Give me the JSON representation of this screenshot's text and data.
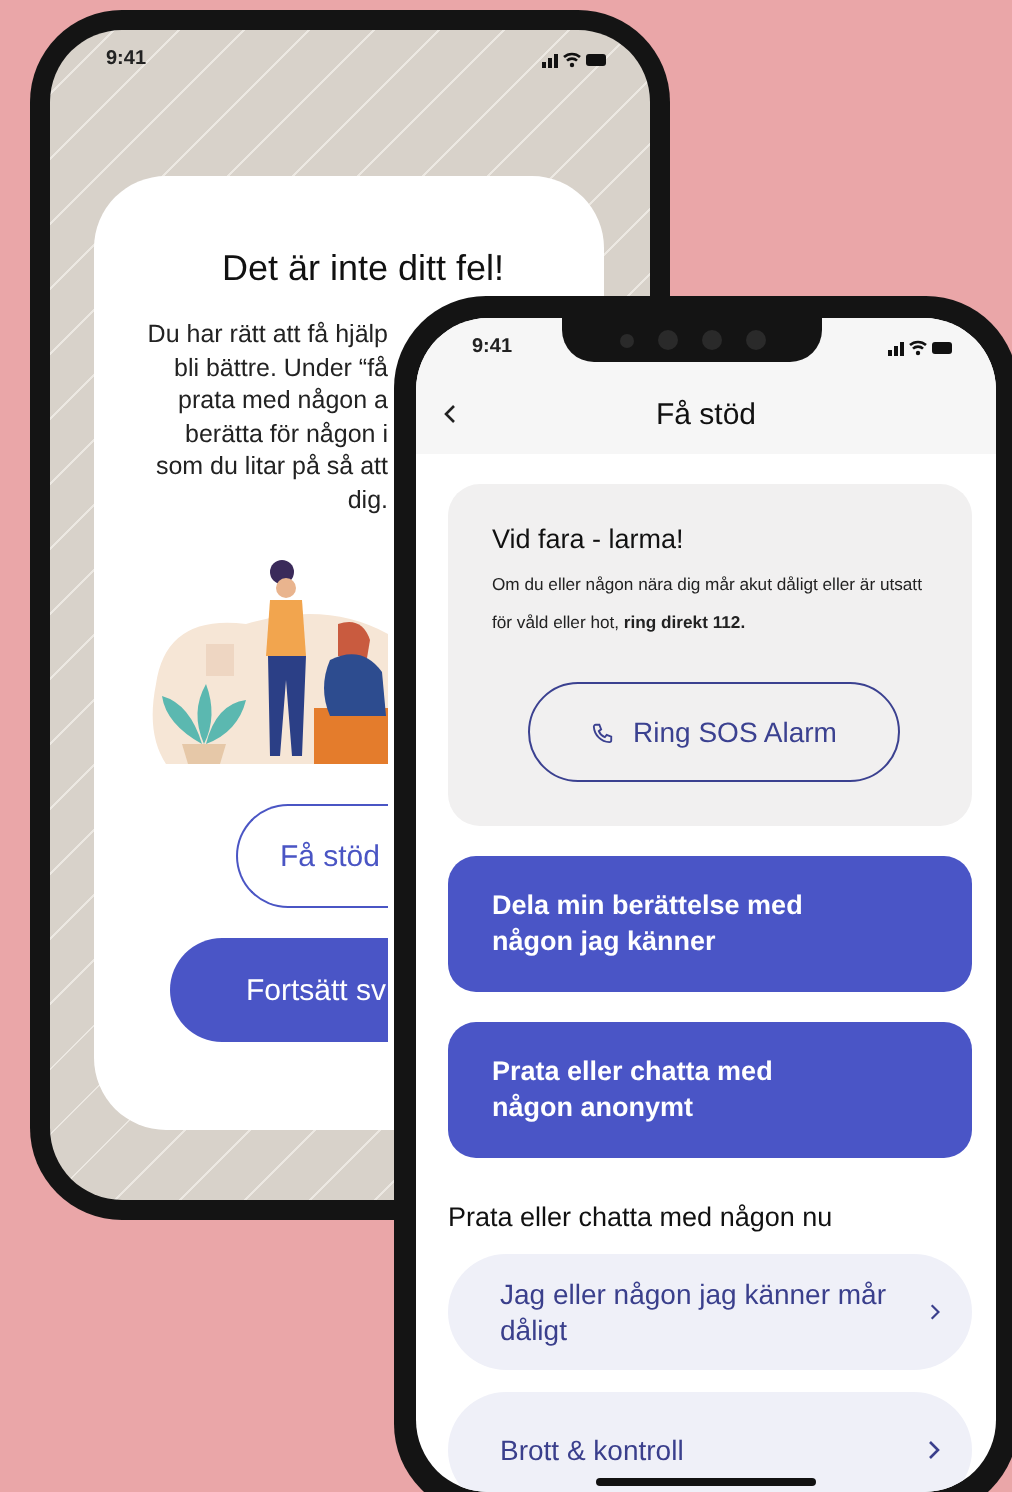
{
  "back_screen": {
    "status_time": "9:41",
    "title": "Det är inte ditt fel!",
    "body_lines": [
      "Du har rätt att få hjälp",
      "bli bättre. Under “få",
      "prata med någon a",
      "berätta för någon i",
      "som du litar på så att",
      "dig."
    ],
    "buttons": [
      {
        "label": "Få stöd",
        "kind": "outline"
      },
      {
        "label": "Fortsätt sv",
        "kind": "filled"
      }
    ]
  },
  "front_screen": {
    "status_time": "9:41",
    "header": {
      "title": "Få stöd"
    },
    "alert_card": {
      "title": "Vid fara - larma!",
      "text": "Om du eller någon nära dig mår akut dåligt eller är utsatt för våld eller hot, **ring direkt 112.**",
      "button": "Ring SOS Alarm"
    },
    "actions": [
      "Dela min berättelse med någon jag känner",
      "Prata eller chatta med någon anonymt"
    ],
    "section_title": "Prata eller chatta med någon nu",
    "list_items": [
      "Jag eller någon jag känner mår dåligt",
      "Brott & kontroll"
    ]
  }
}
